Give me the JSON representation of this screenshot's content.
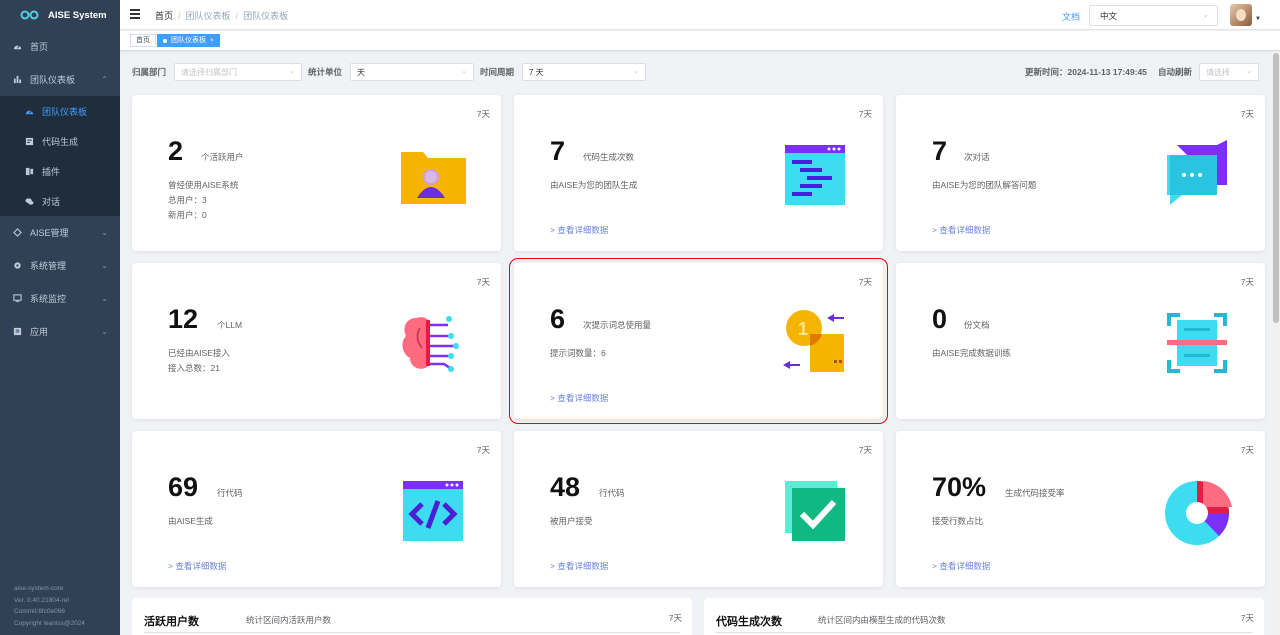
{
  "app": {
    "title": "AISE System"
  },
  "sidebar": {
    "items": [
      {
        "label": "首页",
        "icon": "dashboard-icon"
      },
      {
        "label": "团队仪表板",
        "icon": "bar-chart-icon",
        "expanded": true,
        "children": [
          {
            "label": "团队仪表板",
            "icon": "dashboard-icon",
            "active": true
          },
          {
            "label": "代码生成",
            "icon": "code-icon"
          },
          {
            "label": "插件",
            "icon": "plugin-icon"
          },
          {
            "label": "对话",
            "icon": "chat-icon"
          }
        ]
      },
      {
        "label": "AISE管理",
        "icon": "ai-icon"
      },
      {
        "label": "系统管理",
        "icon": "gear-icon"
      },
      {
        "label": "系统监控",
        "icon": "monitor-icon"
      },
      {
        "label": "应用",
        "icon": "app-icon"
      }
    ],
    "footer": [
      "aise-system-core",
      "Ver. 0.40.21804-rel",
      "Commit:6fc0e096",
      "Copyright leaniss@2024"
    ]
  },
  "header": {
    "breadcrumb": [
      "首页",
      "团队仪表板",
      "团队仪表板"
    ],
    "doc_link": "文档",
    "language": "中文"
  },
  "tags": [
    {
      "label": "首页",
      "active": false
    },
    {
      "label": "团队仪表板",
      "active": true,
      "close": "×"
    }
  ],
  "filters": {
    "dept_label": "归属部门",
    "dept_placeholder": "请选择归属部门",
    "unit_label": "统计单位",
    "unit_value": "天",
    "period_label": "时间周期",
    "period_value": "7 天",
    "updated": "更新时间：2024-11-13 17:49:45",
    "auto_refresh_label": "自动刷新",
    "auto_refresh_placeholder": "请选择"
  },
  "cards": [
    {
      "period": "7天",
      "value": "2",
      "unit": "个活跃用户",
      "desc": [
        "曾经使用AISE系统",
        "总用户：3",
        "新用户：0"
      ],
      "link": "",
      "icon": "user-folder-icon"
    },
    {
      "period": "7天",
      "value": "7",
      "unit": "代码生成次数",
      "desc": [
        "由AISE为您的团队生成"
      ],
      "link": "> 查看详细数据",
      "icon": "code-window-icon"
    },
    {
      "period": "7天",
      "value": "7",
      "unit": "次对话",
      "desc": [
        "由AISE为您的团队解答问题"
      ],
      "link": "> 查看详细数据",
      "icon": "chat-bubble-icon"
    },
    {
      "period": "7天",
      "value": "12",
      "unit": "个LLM",
      "desc": [
        "已经由AISE接入",
        "接入总数：21"
      ],
      "link": "",
      "icon": "brain-icon"
    },
    {
      "period": "7天",
      "value": "6",
      "unit": "次提示词总使用量",
      "desc": [
        "提示词数量：6"
      ],
      "link": "> 查看详细数据",
      "icon": "token-exchange-icon"
    },
    {
      "period": "7天",
      "value": "0",
      "unit": "份文档",
      "desc": [
        "由AISE完成数据训练"
      ],
      "link": "",
      "icon": "scan-icon"
    },
    {
      "period": "7天",
      "value": "69",
      "unit": "行代码",
      "desc": [
        "由AISE生成"
      ],
      "link": "> 查看详细数据",
      "icon": "code-tag-icon"
    },
    {
      "period": "7天",
      "value": "48",
      "unit": "行代码",
      "desc": [
        "被用户接受"
      ],
      "link": "> 查看详细数据",
      "icon": "checkbox-icon"
    },
    {
      "period": "7天",
      "value": "70%",
      "unit": "生成代码接受率",
      "desc": [
        "接受行数占比"
      ],
      "link": "> 查看详细数据",
      "icon": "pie-icon"
    }
  ],
  "panels": [
    {
      "title": "活跃用户数",
      "subtitle": "统计区间内活跃用户数",
      "period": "7天"
    },
    {
      "title": "代码生成次数",
      "subtitle": "统计区间内由模型生成的代码次数",
      "period": "7天"
    }
  ]
}
